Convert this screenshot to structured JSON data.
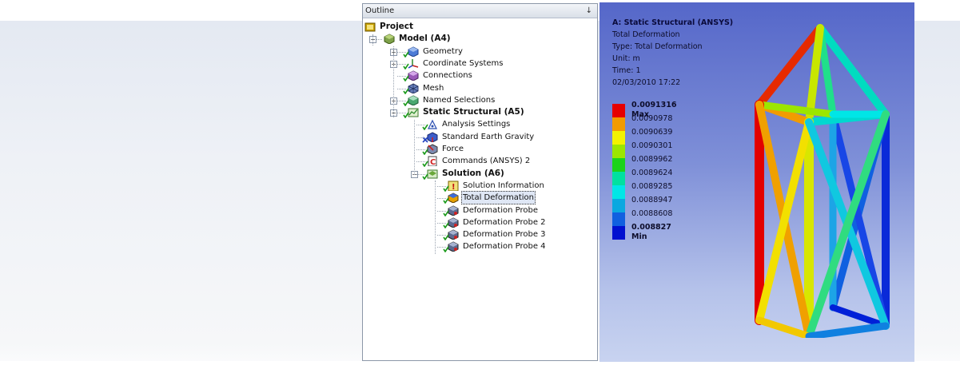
{
  "outline": {
    "title": "Outline",
    "pin_glyph": "ф",
    "nodes": [
      {
        "label": "Project",
        "icon": "project-icon",
        "bold": true
      },
      {
        "label": "Model (A4)",
        "icon": "model-icon",
        "bold": true
      },
      {
        "label": "Geometry",
        "icon": "geometry-icon"
      },
      {
        "label": "Coordinate Systems",
        "icon": "coordinate-systems-icon"
      },
      {
        "label": "Connections",
        "icon": "connections-icon"
      },
      {
        "label": "Mesh",
        "icon": "mesh-icon"
      },
      {
        "label": "Named Selections",
        "icon": "named-selections-icon"
      },
      {
        "label": "Static Structural (A5)",
        "icon": "static-structural-icon",
        "bold": true
      },
      {
        "label": "Analysis Settings",
        "icon": "analysis-settings-icon"
      },
      {
        "label": "Standard Earth Gravity",
        "icon": "gravity-icon"
      },
      {
        "label": "Force",
        "icon": "force-icon"
      },
      {
        "label": "Commands (ANSYS) 2",
        "icon": "commands-icon"
      },
      {
        "label": "Solution (A6)",
        "icon": "solution-icon",
        "bold": true
      },
      {
        "label": "Solution Information",
        "icon": "solution-information-icon"
      },
      {
        "label": "Total Deformation",
        "icon": "total-deformation-icon",
        "selected": true
      },
      {
        "label": "Deformation Probe",
        "icon": "deformation-probe-icon"
      },
      {
        "label": "Deformation Probe 2",
        "icon": "deformation-probe-icon"
      },
      {
        "label": "Deformation Probe 3",
        "icon": "deformation-probe-icon"
      },
      {
        "label": "Deformation Probe 4",
        "icon": "deformation-probe-icon"
      }
    ]
  },
  "viewport": {
    "info": {
      "title": "A: Static Structural (ANSYS)",
      "result": "Total Deformation",
      "type": "Type: Total Deformation",
      "unit": "Unit: m",
      "time": "Time: 1",
      "date": "02/03/2010 17:22"
    },
    "legend": [
      {
        "label": "0.0091316 Max",
        "color": "#e60000",
        "bold": true
      },
      {
        "label": "0.0090978",
        "color": "#f29b00"
      },
      {
        "label": "0.0090639",
        "color": "#f2f200"
      },
      {
        "label": "0.0090301",
        "color": "#9ce600"
      },
      {
        "label": "0.0089962",
        "color": "#1bd31b"
      },
      {
        "label": "0.0089624",
        "color": "#00e0a0"
      },
      {
        "label": "0.0089285",
        "color": "#00e6e6"
      },
      {
        "label": "0.0088947",
        "color": "#0aa8e0"
      },
      {
        "label": "0.0088608",
        "color": "#1060e0"
      },
      {
        "label": "0.008827 Min",
        "color": "#0010d0",
        "bold": true
      }
    ]
  }
}
